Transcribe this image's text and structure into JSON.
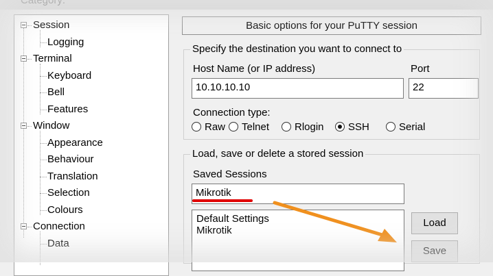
{
  "header": {
    "partial_label": "Category:"
  },
  "tree": [
    {
      "label": "Session",
      "level": 0,
      "expander": true
    },
    {
      "label": "Logging",
      "level": 1
    },
    {
      "label": "Terminal",
      "level": 0,
      "expander": true
    },
    {
      "label": "Keyboard",
      "level": 1
    },
    {
      "label": "Bell",
      "level": 1
    },
    {
      "label": "Features",
      "level": 1
    },
    {
      "label": "Window",
      "level": 0,
      "expander": true
    },
    {
      "label": "Appearance",
      "level": 1
    },
    {
      "label": "Behaviour",
      "level": 1
    },
    {
      "label": "Translation",
      "level": 1
    },
    {
      "label": "Selection",
      "level": 1
    },
    {
      "label": "Colours",
      "level": 1
    },
    {
      "label": "Connection",
      "level": 0,
      "expander": true
    },
    {
      "label": "Data",
      "level": 1
    }
  ],
  "panel": {
    "banner": "Basic options for your PuTTY session",
    "destination_title": "Specify the destination you want to connect to",
    "host_label": "Host Name (or IP address)",
    "host_value": "10.10.10.10",
    "port_label": "Port",
    "port_value": "22",
    "conn_type_label": "Connection type:",
    "conn_types": [
      {
        "label": "Raw",
        "selected": false
      },
      {
        "label": "Telnet",
        "selected": false
      },
      {
        "label": "Rlogin",
        "selected": false
      },
      {
        "label": "SSH",
        "selected": true
      },
      {
        "label": "Serial",
        "selected": false
      }
    ],
    "sessions_title": "Load, save or delete a stored session",
    "saved_sessions_label": "Saved Sessions",
    "saved_sessions_value": "Mikrotik",
    "sessions_list": [
      "Default Settings",
      "Mikrotik"
    ],
    "load_label": "Load",
    "save_label": "Save"
  },
  "annotations": {
    "underline_color": "#e00000",
    "arrow_color": "#f0901e"
  }
}
